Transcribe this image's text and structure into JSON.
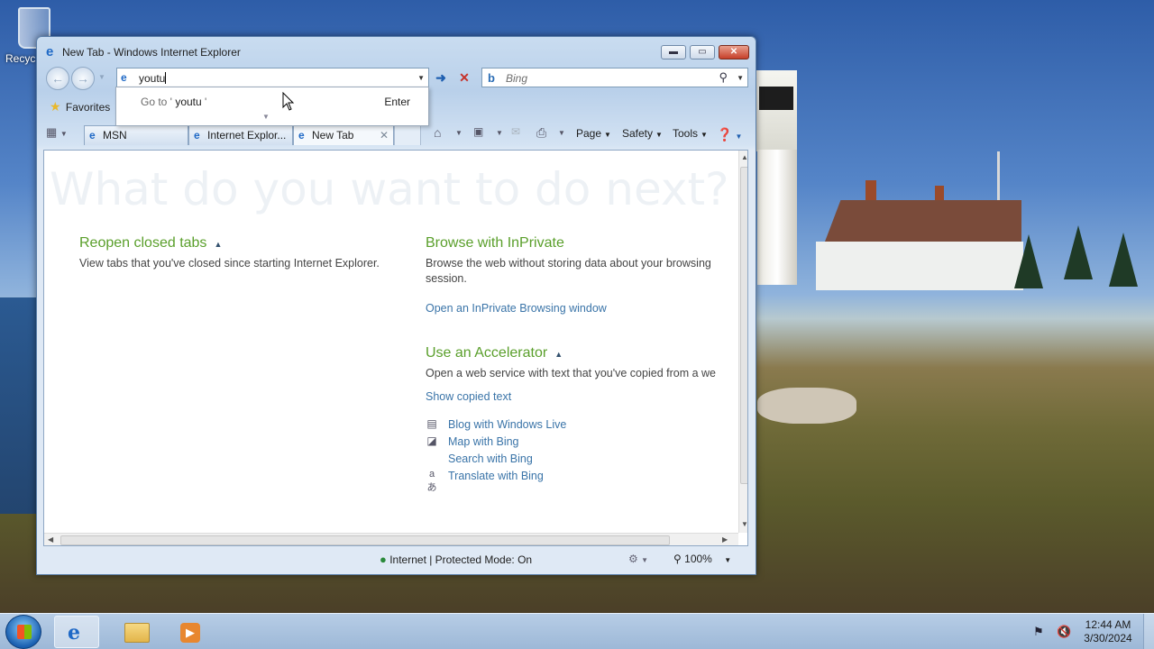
{
  "desktop": {
    "recycle_bin_label": "Recyc"
  },
  "window": {
    "title": "New Tab - Windows Internet Explorer",
    "address_value": "youtu",
    "search_placeholder": "Bing",
    "favorites_label": "Favorites",
    "tabs": [
      {
        "label": "MSN"
      },
      {
        "label": "Internet Explor..."
      },
      {
        "label": "New Tab"
      }
    ],
    "commands": {
      "page": "Page",
      "safety": "Safety",
      "tools": "Tools"
    },
    "autocomplete": {
      "goto_prefix": "Go to '",
      "goto_query": "youtu",
      "goto_suffix": "'",
      "enter_label": "Enter"
    }
  },
  "content": {
    "heading": "What do you want to do next?",
    "reopen": {
      "title": "Reopen closed tabs",
      "description": "View tabs that you've closed since starting Internet Explorer."
    },
    "inprivate": {
      "title": "Browse with InPrivate",
      "description_line1": "Browse the web without storing data about your browsing",
      "description_line2": "session.",
      "link": "Open an InPrivate Browsing window"
    },
    "accelerator": {
      "title": "Use an Accelerator",
      "description": "Open a web service with text that you've copied from a we",
      "show_copied": "Show copied text",
      "items": [
        {
          "label": "Blog with Windows Live",
          "icon": "blog-icon"
        },
        {
          "label": "Map with Bing",
          "icon": "map-icon"
        },
        {
          "label": "Search with Bing",
          "icon": "none"
        },
        {
          "label": "Translate with Bing",
          "icon": "translate-icon"
        }
      ]
    }
  },
  "statusbar": {
    "zone": "Internet | Protected Mode: On",
    "zoom": "100%"
  },
  "taskbar": {
    "time": "12:44 AM",
    "date": "3/30/2024"
  },
  "colors": {
    "section_heading": "#5a9f2b",
    "link": "#3a74a8",
    "ie_blue": "#1f69c6"
  }
}
